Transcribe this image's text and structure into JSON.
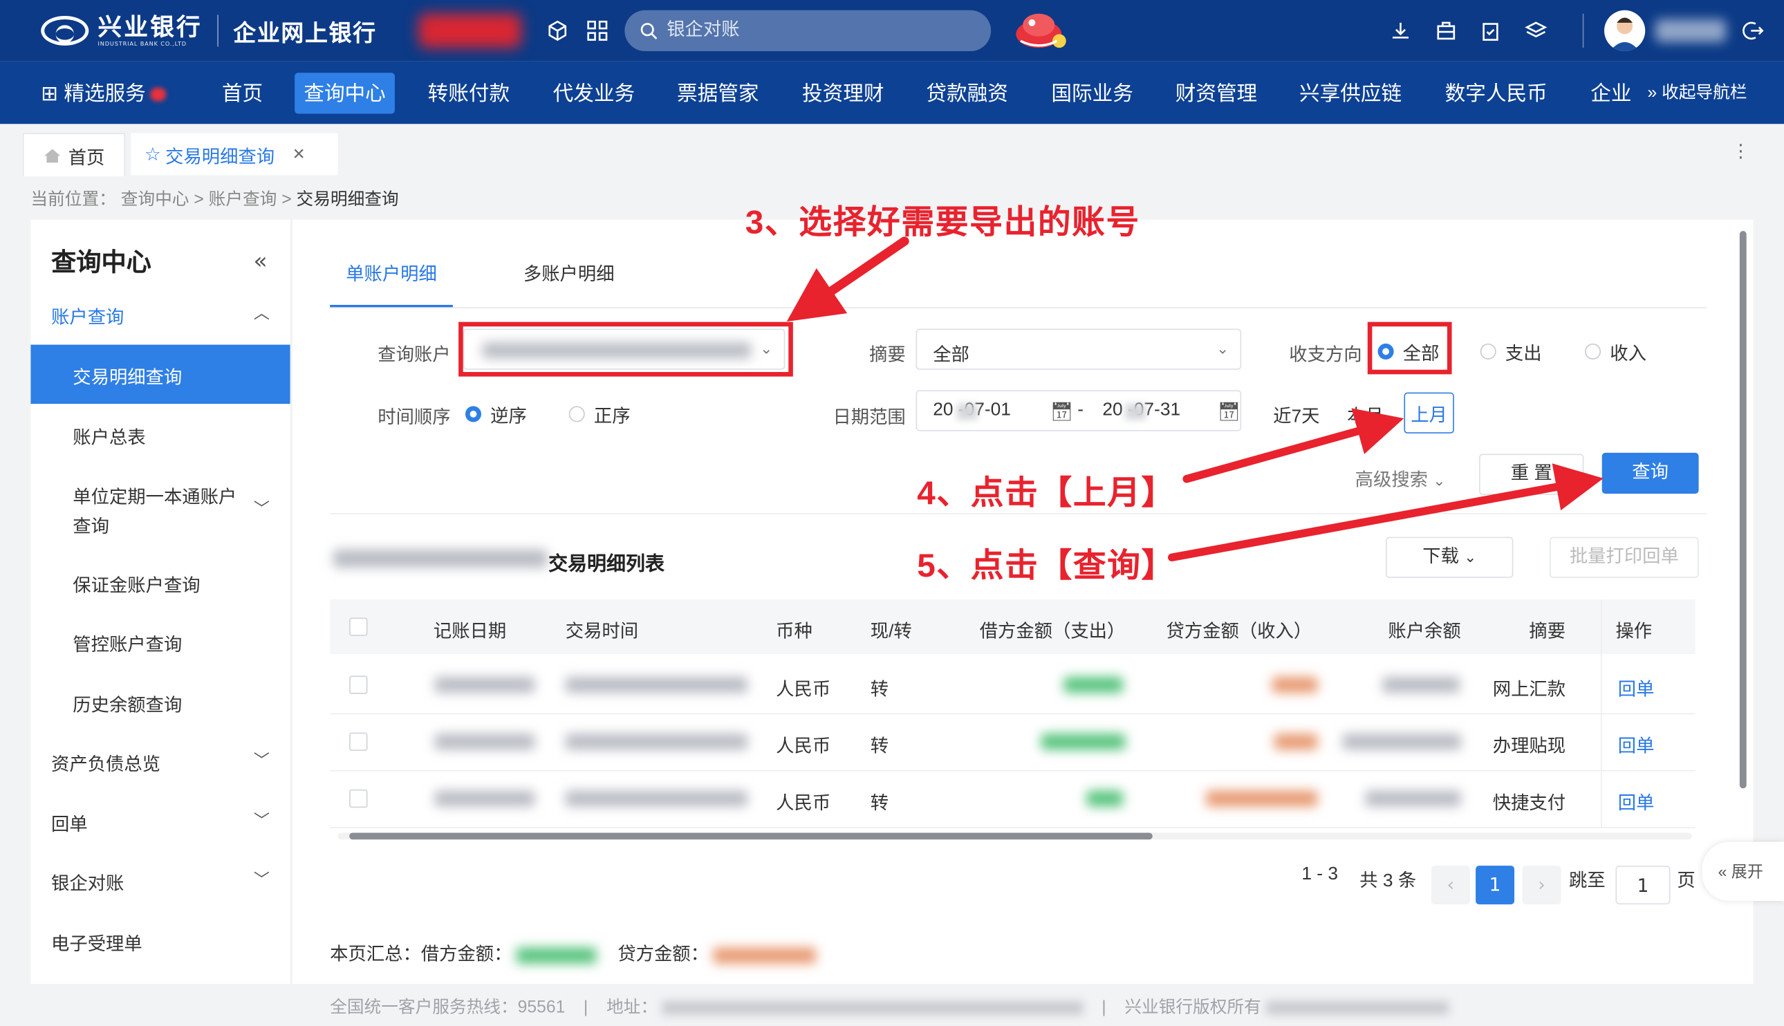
{
  "header": {
    "bank_name": "兴业银行",
    "bank_name_en": "INDUSTRIAL BANK CO.,LTD",
    "site_name": "企业网上银行",
    "search_placeholder": "银企对账"
  },
  "nav": {
    "items": [
      "精选服务",
      "首页",
      "查询中心",
      "转账付款",
      "代发业务",
      "票据管家",
      "投资理财",
      "贷款融资",
      "国际业务",
      "财资管理",
      "兴享供应链",
      "数字人民币",
      "企业"
    ],
    "active": "查询中心",
    "collapse_label": "收起导航栏"
  },
  "tabs": {
    "home": "首页",
    "current": "交易明细查询"
  },
  "breadcrumb": {
    "prefix": "当前位置：",
    "items": [
      "查询中心",
      "账户查询",
      "交易明细查询"
    ]
  },
  "sidebar": {
    "title": "查询中心",
    "items": [
      {
        "label": "账户查询",
        "kind": "group-open"
      },
      {
        "label": "交易明细查询",
        "kind": "active"
      },
      {
        "label": "账户总表",
        "kind": "sub"
      },
      {
        "label": "单位定期一本通账户",
        "label2": "查询",
        "kind": "sub-group"
      },
      {
        "label": "保证金账户查询",
        "kind": "sub"
      },
      {
        "label": "管控账户查询",
        "kind": "sub"
      },
      {
        "label": "历史余额查询",
        "kind": "sub"
      },
      {
        "label": "资产负债总览",
        "kind": "group"
      },
      {
        "label": "回单",
        "kind": "group"
      },
      {
        "label": "银企对账",
        "kind": "group"
      },
      {
        "label": "电子受理单",
        "kind": "item"
      }
    ]
  },
  "main": {
    "tabs": [
      "单账户明细",
      "多账户明细"
    ],
    "form": {
      "account_label": "查询账户",
      "summary_label": "摘要",
      "summary_value": "全部",
      "direction_label": "收支方向",
      "direction_options": [
        "全部",
        "支出",
        "收入"
      ],
      "direction_selected": "全部",
      "order_label": "时间顺序",
      "order_options": [
        "逆序",
        "正序"
      ],
      "order_selected": "逆序",
      "date_label": "日期范围",
      "date_start": "20  -07-01",
      "date_sep": "-",
      "date_end": "20  -07-31",
      "quick": [
        "近7天",
        "本月",
        "上月"
      ],
      "advanced": "高级搜索",
      "reset": "重 置",
      "query": "查询"
    },
    "list": {
      "title": "交易明细列表",
      "download": "下载",
      "batch_print": "批量打印回单",
      "columns": [
        "记账日期",
        "交易时间",
        "币种",
        "现/转",
        "借方金额（支出）",
        "贷方金额（收入）",
        "账户余额",
        "摘要",
        "操作"
      ],
      "rows": [
        {
          "currency": "人民币",
          "type": "转",
          "summary": "网上汇款",
          "op": "回单"
        },
        {
          "currency": "人民币",
          "type": "转",
          "summary": "办理贴现",
          "op": "回单"
        },
        {
          "currency": "人民币",
          "type": "转",
          "summary": "快捷支付",
          "op": "回单"
        }
      ]
    },
    "pagination": {
      "range": "1 - 3",
      "total": "共 3 条",
      "current": "1",
      "goto_label": "跳至",
      "goto_value": "1",
      "page_unit": "页"
    },
    "summary": {
      "debit_label": "本页汇总：借方金额：",
      "credit_label": "贷方金额："
    }
  },
  "footer": {
    "hotline": "全国统一客户服务热线：95561",
    "address_label": "地址：",
    "copyright": "兴业银行版权所有"
  },
  "expand_label": "展开",
  "annotations": {
    "step3": "3、选择好需要导出的账号",
    "step4": "4、点击【上月】",
    "step5": "5、点击【查询】"
  },
  "colors": {
    "header_bg": "#0c3a86",
    "nav_bg": "#0d4194",
    "accent": "#2e7fe6",
    "annotation_red": "#e8232e"
  }
}
